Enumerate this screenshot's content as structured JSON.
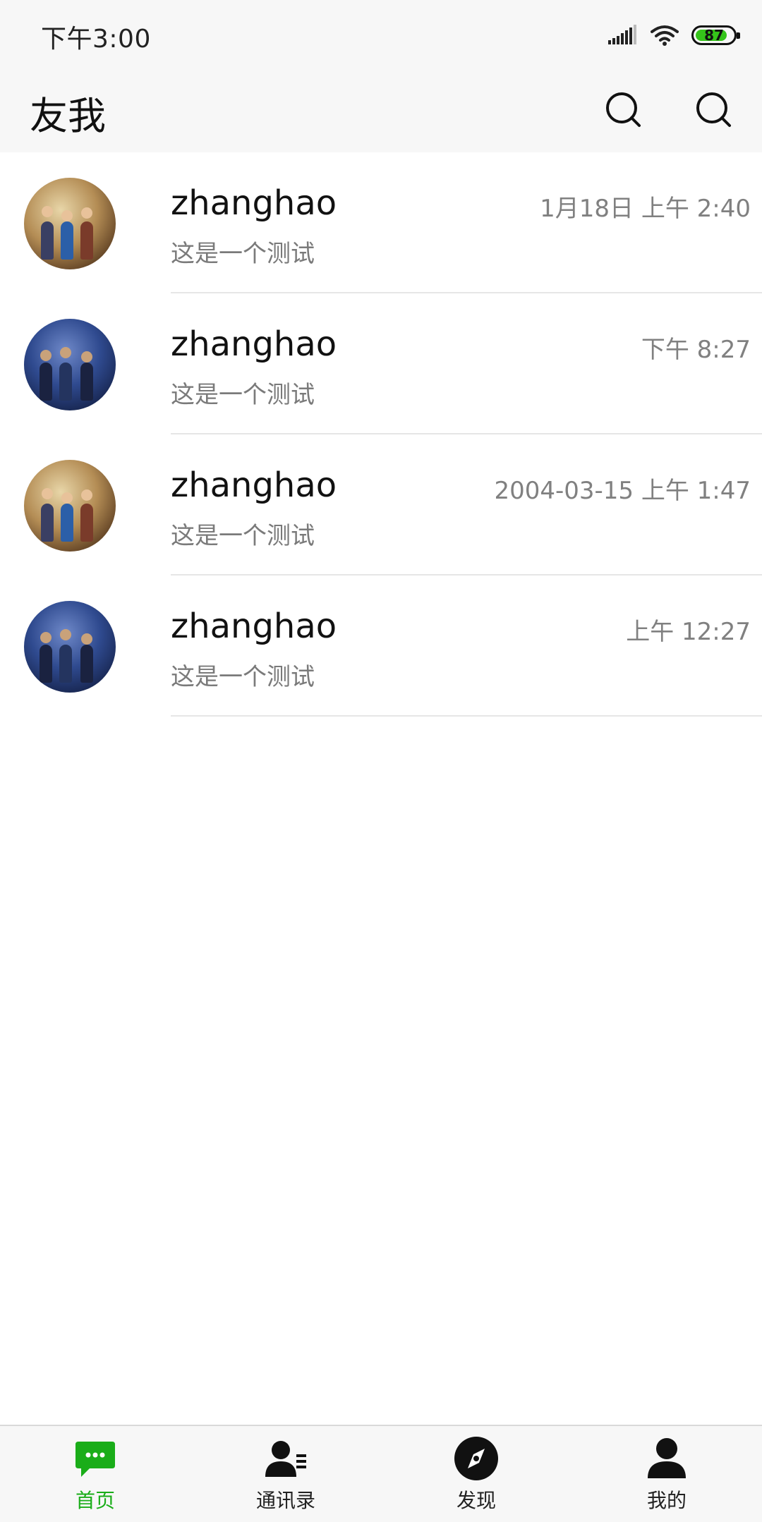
{
  "status_bar": {
    "time": "下午3:00",
    "battery_level": "87"
  },
  "header": {
    "title": "友我",
    "actions": [
      {
        "icon": "search-icon"
      },
      {
        "icon": "search-icon"
      }
    ]
  },
  "chats": [
    {
      "name": "zhanghao",
      "preview": "这是一个测试",
      "time": "1月18日 上午 2:40",
      "avatar": "avatar-scene-a"
    },
    {
      "name": "zhanghao",
      "preview": "这是一个测试",
      "time": "下午 8:27",
      "avatar": "avatar-scene-b"
    },
    {
      "name": "zhanghao",
      "preview": "这是一个测试",
      "time": "2004-03-15 上午 1:47",
      "avatar": "avatar-scene-a"
    },
    {
      "name": "zhanghao",
      "preview": "这是一个测试",
      "time": "上午 12:27",
      "avatar": "avatar-scene-b"
    }
  ],
  "bottom_nav": {
    "items": [
      {
        "label": "首页",
        "icon": "chat-bubble-icon",
        "active": true
      },
      {
        "label": "通讯录",
        "icon": "contacts-icon",
        "active": false
      },
      {
        "label": "发现",
        "icon": "compass-icon",
        "active": false
      },
      {
        "label": "我的",
        "icon": "person-icon",
        "active": false
      }
    ]
  },
  "colors": {
    "accent": "#1aad19",
    "bar_background": "#f7f7f7",
    "battery_fill": "#35c41a"
  }
}
